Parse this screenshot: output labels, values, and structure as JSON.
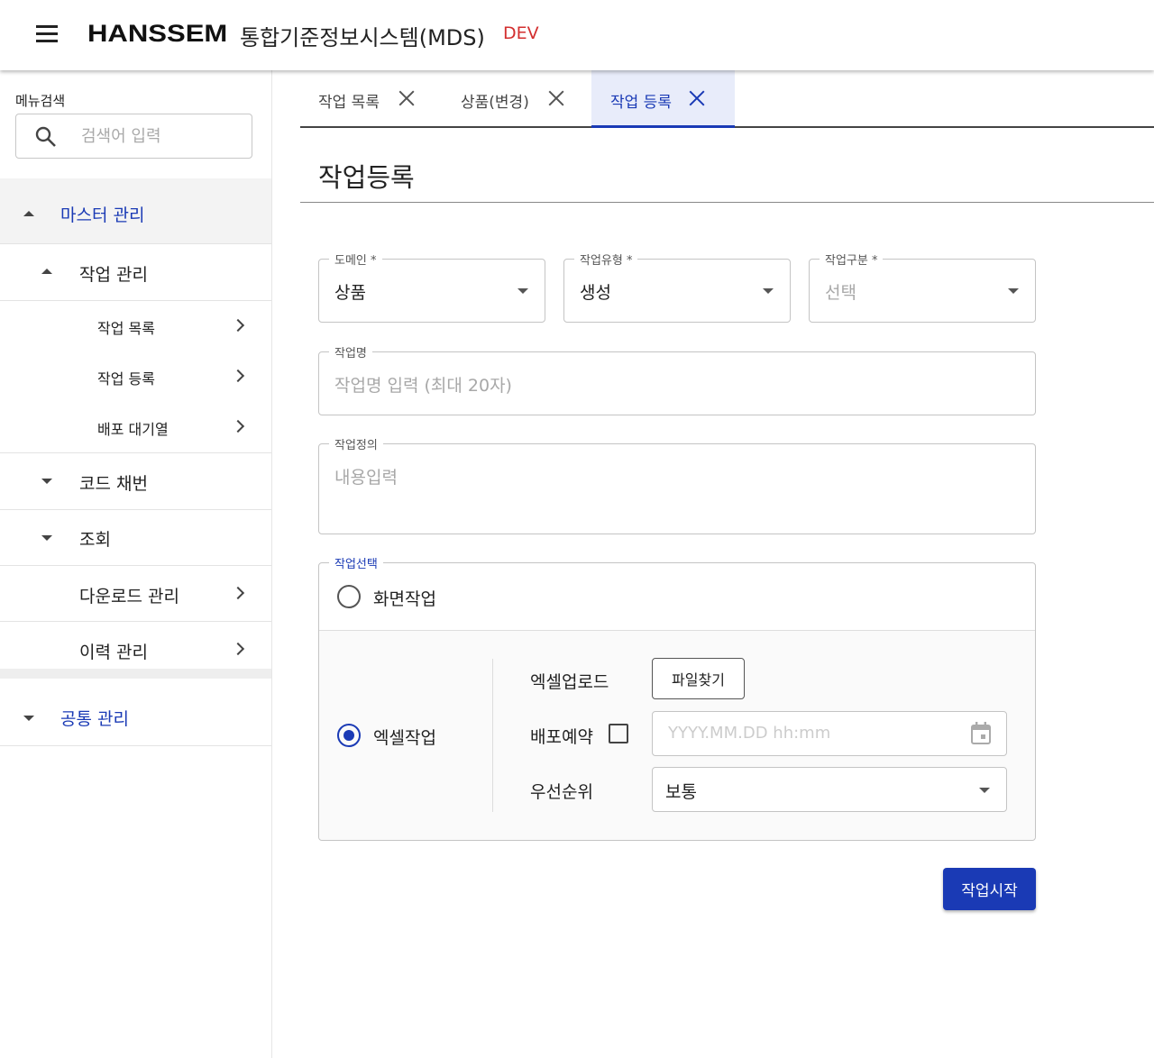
{
  "header": {
    "logo": "HANSSEM",
    "title": "통합기준정보시스템(MDS)",
    "env": "DEV"
  },
  "sidebar": {
    "search_label": "메뉴검색",
    "search_placeholder": "검색어 입력",
    "groups": [
      {
        "label": "마스터 관리"
      },
      {
        "label": "작업 관리"
      },
      {
        "label": "작업 목록"
      },
      {
        "label": "작업 등록"
      },
      {
        "label": "배포 대기열"
      },
      {
        "label": "코드 채번"
      },
      {
        "label": "조회"
      },
      {
        "label": "다운로드 관리"
      },
      {
        "label": "이력 관리"
      },
      {
        "label": "공통 관리"
      }
    ]
  },
  "tabs": [
    {
      "label": "작업 목록"
    },
    {
      "label": "상품(변경)"
    },
    {
      "label": "작업 등록"
    }
  ],
  "page_title": "작업등록",
  "form": {
    "domain": {
      "label": "도메인 *",
      "value": "상품"
    },
    "work_type": {
      "label": "작업유형 *",
      "value": "생성"
    },
    "work_category": {
      "label": "작업구분 *",
      "value": "선택"
    },
    "work_name": {
      "label": "작업명",
      "placeholder": "작업명 입력 (최대 20자)"
    },
    "work_def": {
      "label": "작업정의",
      "placeholder": "내용입력"
    },
    "work_select": {
      "label": "작업선택",
      "screen_option": "화면작업",
      "excel_option": "엑셀작업",
      "excel_upload_label": "엑셀업로드",
      "file_button": "파일찾기",
      "deploy_label": "배포예약",
      "deploy_placeholder": "YYYY.MM.DD hh:mm",
      "priority_label": "우선순위",
      "priority_value": "보통"
    },
    "submit": "작업시작"
  },
  "colors": {
    "accent": "#1a3ab5",
    "env": "#d32f2f"
  }
}
